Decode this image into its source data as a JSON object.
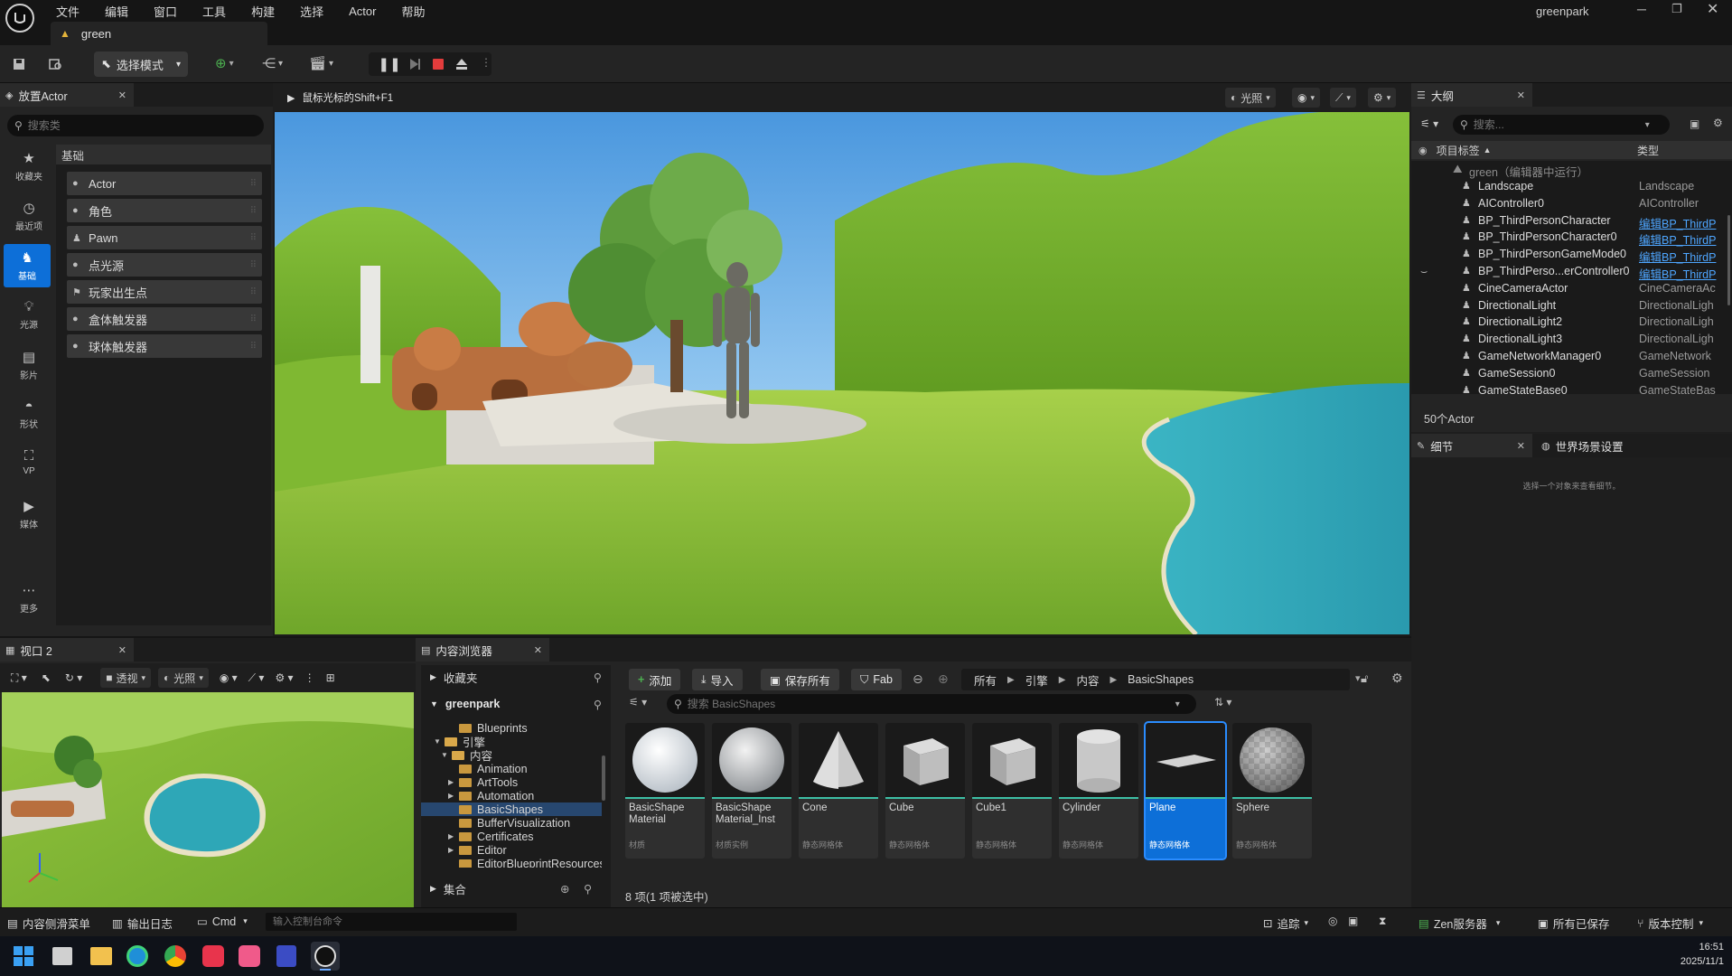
{
  "window": {
    "project": "greenpark",
    "level_tab": "green",
    "menu": [
      "文件",
      "编辑",
      "窗口",
      "工具",
      "构建",
      "选择",
      "Actor",
      "帮助"
    ]
  },
  "toolbar": {
    "mode_label": "选择模式"
  },
  "place_actors": {
    "tab": "放置Actor",
    "search_placeholder": "搜索类",
    "category": "基础",
    "side_nav": [
      {
        "label": "收藏夹",
        "icon": "star-icon"
      },
      {
        "label": "最近项",
        "icon": "clock-icon"
      },
      {
        "label": "基础",
        "icon": "basic-icon",
        "active": true
      },
      {
        "label": "光源",
        "icon": "bulb-icon"
      },
      {
        "label": "影片",
        "icon": "film-icon"
      },
      {
        "label": "形状",
        "icon": "shapes-icon"
      },
      {
        "label": "VP",
        "icon": "vp-icon"
      },
      {
        "label": "媒体",
        "icon": "media-icon"
      },
      {
        "label": "更多",
        "icon": "more-icon"
      }
    ],
    "items": [
      "Actor",
      "角色",
      "Pawn",
      "点光源",
      "玩家出生点",
      "盒体触发器",
      "球体触发器"
    ]
  },
  "viewport": {
    "hint": "鼠标光标的Shift+F1",
    "lighting": "光照"
  },
  "outliner": {
    "tab": "大纲",
    "search_placeholder": "搜索...",
    "col_label": "项目标签",
    "col_type": "类型",
    "level_row": "green（编辑器中运行）",
    "rows": [
      {
        "name": "Landscape",
        "type": "Landscape",
        "link": false
      },
      {
        "name": "AIController0",
        "type": "AIController",
        "link": false
      },
      {
        "name": "BP_ThirdPersonCharacter",
        "type": "编辑BP_ThirdP",
        "link": true
      },
      {
        "name": "BP_ThirdPersonCharacter0",
        "type": "编辑BP_ThirdP",
        "link": true
      },
      {
        "name": "BP_ThirdPersonGameMode0",
        "type": "编辑BP_ThirdP",
        "link": true
      },
      {
        "name": "BP_ThirdPerso...erController0",
        "type": "编辑BP_ThirdP",
        "link": true
      },
      {
        "name": "CineCameraActor",
        "type": "CineCameraAc",
        "link": false
      },
      {
        "name": "DirectionalLight",
        "type": "DirectionalLigh",
        "link": false
      },
      {
        "name": "DirectionalLight2",
        "type": "DirectionalLigh",
        "link": false
      },
      {
        "name": "DirectionalLight3",
        "type": "DirectionalLigh",
        "link": false
      },
      {
        "name": "GameNetworkManager0",
        "type": "GameNetwork",
        "link": false
      },
      {
        "name": "GameSession0",
        "type": "GameSession",
        "link": false
      },
      {
        "name": "GameStateBase0",
        "type": "GameStateBas",
        "link": false
      }
    ],
    "count": "50个Actor"
  },
  "details": {
    "tab": "细节",
    "world_tab": "世界场景设置",
    "empty_msg": "选择一个对象来查看细节。"
  },
  "viewport2": {
    "tab": "视口 2",
    "perspective": "透视",
    "lighting": "光照"
  },
  "content_browser": {
    "tab": "内容浏览器",
    "favorites": "收藏夹",
    "project": "greenpark",
    "collections": "集合",
    "tree": [
      {
        "label": "Blueprints",
        "depth": 3,
        "arrow": false
      },
      {
        "label": "引擎",
        "depth": 1,
        "arrow": true,
        "open": true
      },
      {
        "label": "内容",
        "depth": 2,
        "arrow": true,
        "open": true
      },
      {
        "label": "Animation",
        "depth": 3,
        "arrow": false
      },
      {
        "label": "ArtTools",
        "depth": 3,
        "arrow": true
      },
      {
        "label": "Automation",
        "depth": 3,
        "arrow": true
      },
      {
        "label": "BasicShapes",
        "depth": 3,
        "arrow": false,
        "selected": true
      },
      {
        "label": "BufferVisualization",
        "depth": 3,
        "arrow": false
      },
      {
        "label": "Certificates",
        "depth": 3,
        "arrow": true
      },
      {
        "label": "Editor",
        "depth": 3,
        "arrow": true
      },
      {
        "label": "EditorBlueprintResources",
        "depth": 3,
        "arrow": false
      }
    ],
    "add": "添加",
    "import": "导入",
    "save_all": "保存所有",
    "fab": "Fab",
    "breadcrumbs": [
      "所有",
      "引擎",
      "内容",
      "BasicShapes"
    ],
    "search_placeholder": "搜索 BasicShapes",
    "assets": [
      {
        "name": "BasicShape Material",
        "type": "材质",
        "shape": "sphere-white"
      },
      {
        "name": "BasicShape Material_Inst",
        "type": "材质实例",
        "shape": "sphere-grey"
      },
      {
        "name": "Cone",
        "type": "静态网格体",
        "shape": "cone"
      },
      {
        "name": "Cube",
        "type": "静态网格体",
        "shape": "cube"
      },
      {
        "name": "Cube1",
        "type": "静态网格体",
        "shape": "cube"
      },
      {
        "name": "Cylinder",
        "type": "静态网格体",
        "shape": "cylinder"
      },
      {
        "name": "Plane",
        "type": "静态网格体",
        "shape": "plane",
        "selected": true
      },
      {
        "name": "Sphere",
        "type": "静态网格体",
        "shape": "sphere-check"
      }
    ],
    "status": "8 项(1 项被选中)"
  },
  "statusbar": {
    "drawer": "内容侧滑菜单",
    "output_log": "输出日志",
    "cmd": "Cmd",
    "console_placeholder": "输入控制台命令",
    "trace": "追踪",
    "zen": "Zen服务器",
    "saved": "所有已保存",
    "vcs": "版本控制"
  },
  "taskbar": {
    "time": "16:51",
    "date": "2025/11/1"
  },
  "colors": {
    "accent": "#0d6fd8",
    "link": "#4ea6ff",
    "water": "#2ea7b7",
    "grass": "#8cc43a"
  }
}
